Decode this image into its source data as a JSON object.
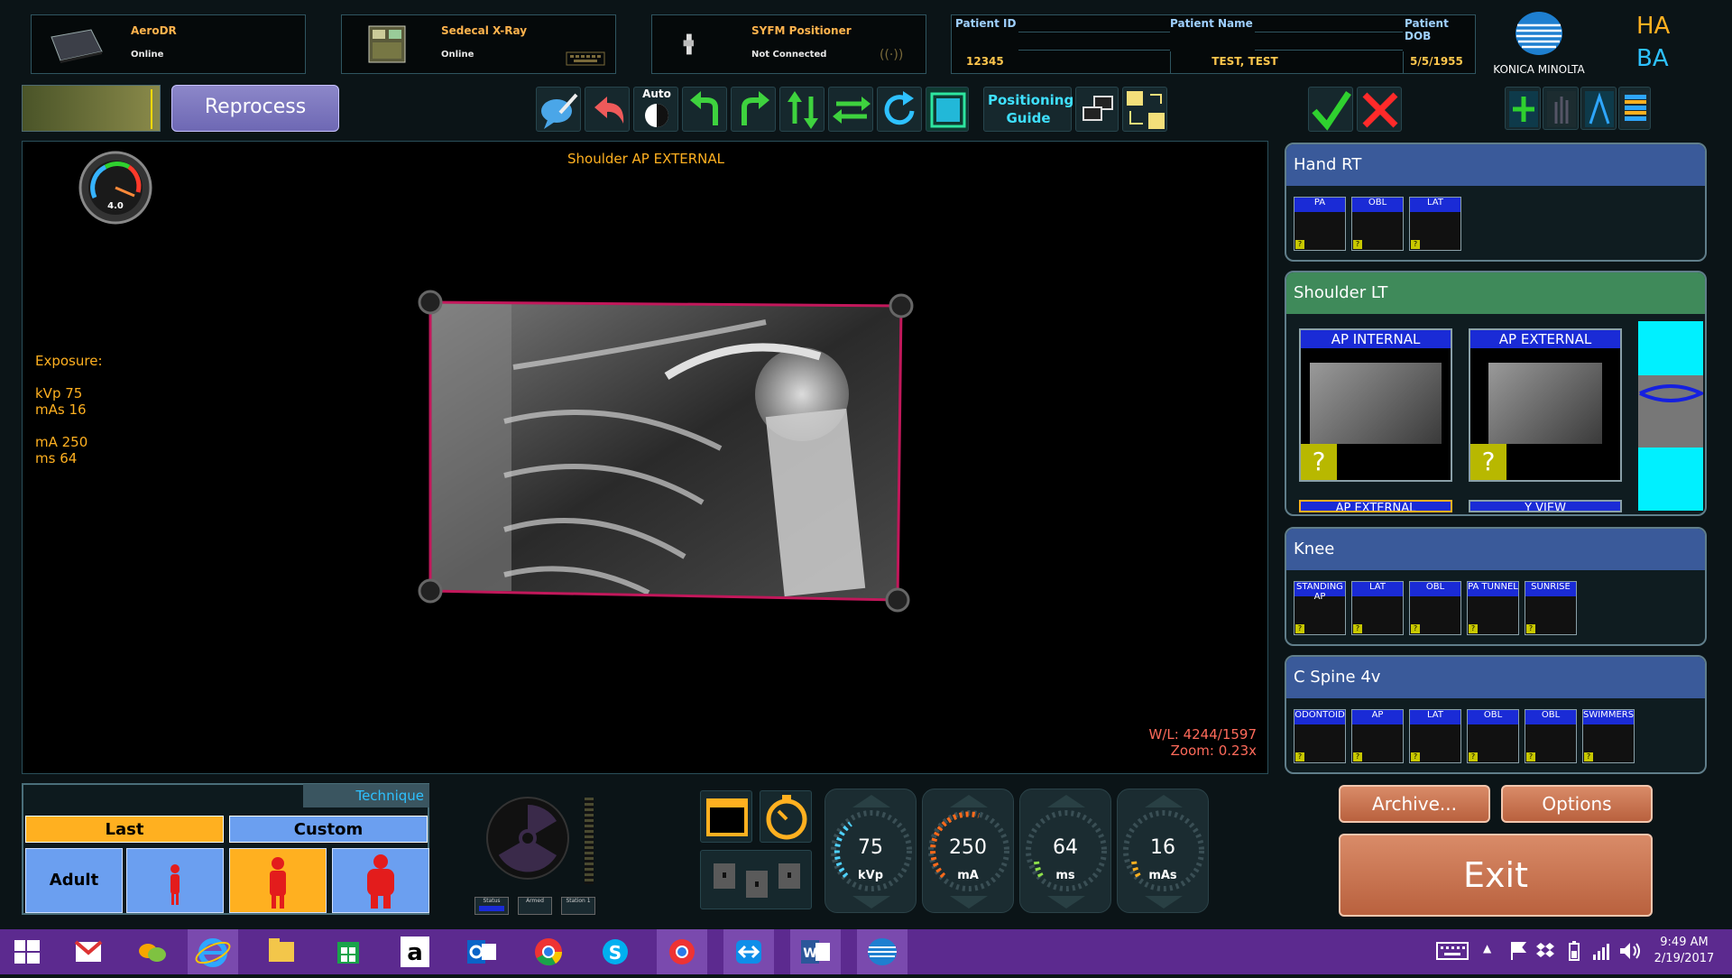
{
  "devices": [
    {
      "name": "AeroDR",
      "status": "Online"
    },
    {
      "name": "Sedecal X-Ray",
      "status": "Online"
    },
    {
      "name": "SYFM Positioner",
      "status": "Not Connected"
    }
  ],
  "patient": {
    "id_label": "Patient ID",
    "id": "12345",
    "name_label": "Patient Name",
    "name": "TEST, TEST",
    "dob_label": "Patient DOB",
    "dob": "5/5/1955"
  },
  "brand": {
    "name": "KONICA MINOLTA",
    "initials_top": "HA",
    "initials_bottom": "BA"
  },
  "toolbar": {
    "reprocess": "Reprocess",
    "auto": "Auto",
    "positioning_guide": "Positioning Guide"
  },
  "viewer": {
    "title": "Shoulder AP EXTERNAL",
    "gauge_value": "4.0",
    "exposure_label": "Exposure:",
    "kvp": "kVp 75",
    "mas": "mAs 16",
    "ma": "mA 250",
    "ms": "ms 64",
    "wl": "W/L: 4244/1597",
    "zoom": "Zoom: 0.23x"
  },
  "panels": {
    "hand": {
      "title": "Hand RT",
      "views": [
        "PA",
        "OBL",
        "LAT"
      ]
    },
    "shoulder": {
      "title": "Shoulder LT",
      "views": [
        "AP INTERNAL",
        "AP EXTERNAL"
      ],
      "cut": [
        "AP EXTERNAL",
        "Y VIEW"
      ]
    },
    "knee": {
      "title": "Knee",
      "views": [
        "STANDING AP",
        "LAT",
        "OBL",
        "PA TUNNEL",
        "SUNRISE"
      ]
    },
    "cspine": {
      "title": "C Spine 4v",
      "views": [
        "ODONTOID",
        "AP",
        "LAT",
        "OBL",
        "OBL",
        "SWIMMERS"
      ]
    }
  },
  "actions": {
    "archive": "Archive...",
    "options": "Options",
    "exit": "Exit"
  },
  "technique": {
    "tab": "Technique",
    "last": "Last",
    "custom": "Custom",
    "adult": "Adult",
    "status_labels": [
      "Status",
      "Armed",
      "Station 1"
    ]
  },
  "gauges": [
    {
      "value": "75",
      "unit": "kVp",
      "color": "#4fd2ff"
    },
    {
      "value": "250",
      "unit": "mA",
      "color": "#ff6a1a"
    },
    {
      "value": "64",
      "unit": "ms",
      "color": "#8ee04a"
    },
    {
      "value": "16",
      "unit": "mAs",
      "color": "#ffb020"
    }
  ],
  "tray": {
    "time": "9:49 AM",
    "date": "2/19/2017"
  },
  "colors": {
    "accent_orange": "#ffb34d",
    "panel_blue": "#3a5a9a",
    "panel_green": "#3f8a5a"
  }
}
